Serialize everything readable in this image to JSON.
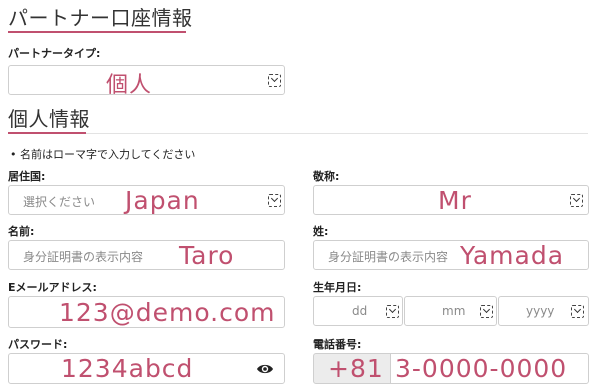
{
  "partner_section": {
    "title": "パートナー口座情報",
    "partner_type_label": "パートナータイプ:",
    "partner_type_value": "個人"
  },
  "personal_section": {
    "title": "個人情報",
    "note_bullet": "•",
    "note": "名前はローマ字で入力してください"
  },
  "residence": {
    "label": "居住国:",
    "placeholder": "選択ください",
    "value": "Japan"
  },
  "title_field": {
    "label": "敬称:",
    "value": "Mr"
  },
  "first_name": {
    "label": "名前:",
    "placeholder": "身分証明書の表示内容",
    "value": "Taro"
  },
  "last_name": {
    "label": "姓:",
    "placeholder": "身分証明書の表示内容",
    "value": "Yamada"
  },
  "email": {
    "label": "Eメールアドレス:",
    "value": "123@demo.com"
  },
  "birthdate": {
    "label": "生年月日:",
    "day_placeholder": "dd",
    "month_placeholder": "mm",
    "year_placeholder": "yyyy"
  },
  "password": {
    "label": "パスワード:",
    "value": "1234abcd",
    "icon": "eye-icon"
  },
  "phone": {
    "label": "電話番号:",
    "country_code": "+81",
    "number": "3-0000-0000"
  },
  "colors": {
    "accent": "#c0506f",
    "border": "#cfcfcf",
    "label": "#222222"
  }
}
